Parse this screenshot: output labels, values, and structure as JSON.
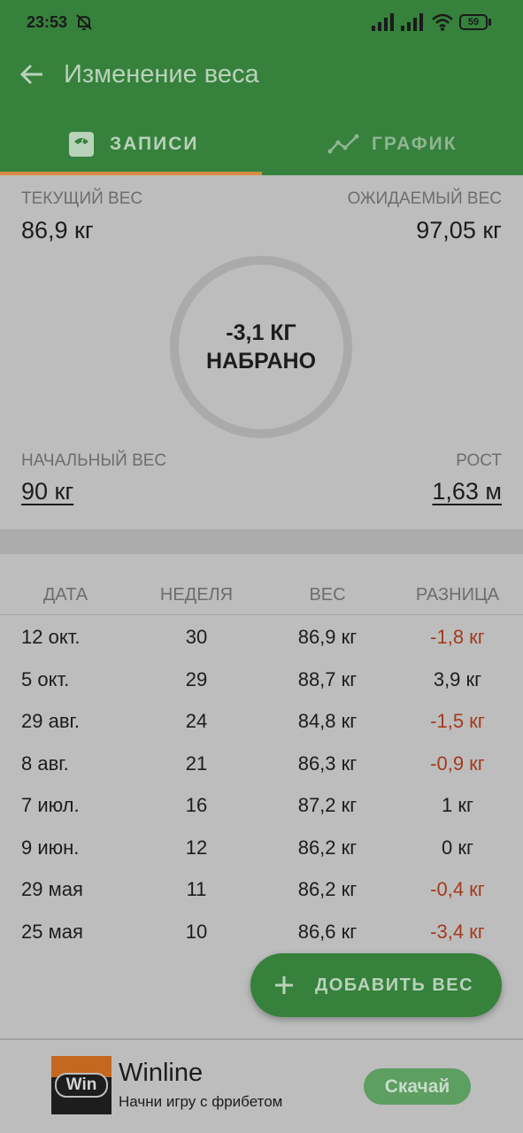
{
  "status_bar": {
    "time": "23:53",
    "battery": "59"
  },
  "header": {
    "title": "Изменение веса"
  },
  "tabs": [
    {
      "label": "ЗАПИСИ",
      "icon": "scale-icon",
      "selected": true
    },
    {
      "label": "ГРАФИК",
      "icon": "line-chart-icon",
      "selected": false
    }
  ],
  "summary": {
    "current_label": "ТЕКУЩИЙ ВЕС",
    "current_value": "86,9 кг",
    "expected_label": "ОЖИДАЕМЫЙ ВЕС",
    "expected_value": "97,05 кг",
    "ring_line1": "-3,1 КГ",
    "ring_line2": "НАБРАНО",
    "start_label": "НАЧАЛЬНЫЙ ВЕС",
    "start_value": "90 кг",
    "height_label": "РОСТ",
    "height_value": "1,63 м"
  },
  "table": {
    "headers": [
      "ДАТА",
      "НЕДЕЛЯ",
      "ВЕС",
      "РАЗНИЦА"
    ],
    "rows": [
      {
        "date": "12 окт.",
        "week": "30",
        "weight": "86,9 кг",
        "diff": "-1,8 кг",
        "negative": true
      },
      {
        "date": "5 окт.",
        "week": "29",
        "weight": "88,7 кг",
        "diff": "3,9 кг",
        "negative": false
      },
      {
        "date": "29 авг.",
        "week": "24",
        "weight": "84,8 кг",
        "diff": "-1,5 кг",
        "negative": true
      },
      {
        "date": "8 авг.",
        "week": "21",
        "weight": "86,3 кг",
        "diff": "-0,9 кг",
        "negative": true
      },
      {
        "date": "7 июл.",
        "week": "16",
        "weight": "87,2 кг",
        "diff": "1 кг",
        "negative": false
      },
      {
        "date": "9 июн.",
        "week": "12",
        "weight": "86,2 кг",
        "diff": "0 кг",
        "negative": false
      },
      {
        "date": "29 мая",
        "week": "11",
        "weight": "86,2 кг",
        "diff": "-0,4 кг",
        "negative": true
      },
      {
        "date": "25 мая",
        "week": "10",
        "weight": "86,6 кг",
        "diff": "-3,4 кг",
        "negative": true
      }
    ]
  },
  "fab": {
    "label": "ДОБАВИТЬ ВЕС"
  },
  "ad": {
    "logo_text": "Win",
    "title": "Winline",
    "subtitle": "Начни игру с фрибетом",
    "button_label": "Скачай"
  },
  "colors": {
    "header_green": "#36813c",
    "tab_indicator": "#d98c3f",
    "negative_red": "#a33a1c",
    "overlay_gray": "#bdbdbd"
  }
}
